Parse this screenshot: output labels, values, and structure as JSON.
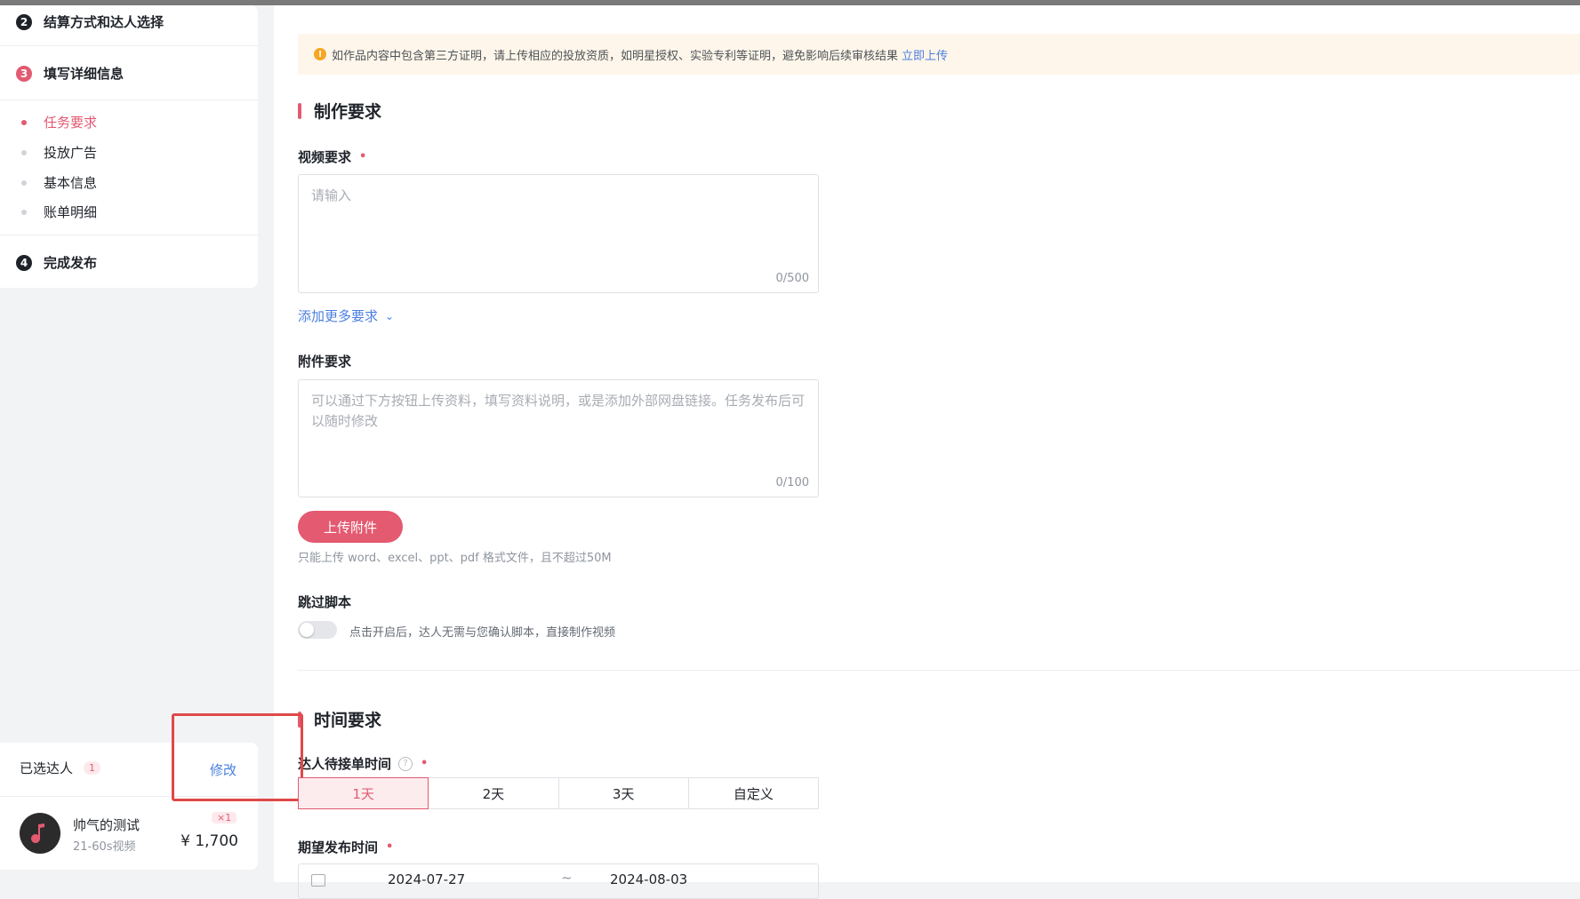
{
  "steps": [
    {
      "num": "2",
      "label": "结算方式和达人选择"
    },
    {
      "num": "3",
      "label": "填写详细信息"
    },
    {
      "num": "4",
      "label": "完成发布"
    }
  ],
  "subitems": [
    "任务要求",
    "投放广告",
    "基本信息",
    "账单明细"
  ],
  "selected": {
    "title": "已选达人",
    "count": "1",
    "edit_label": "修改",
    "name": "帅气的测试",
    "type": "21-60s视频",
    "qty": "×1",
    "price": "¥ 1,700"
  },
  "notice": {
    "text": "如作品内容中包含第三方证明，请上传相应的投放资质，如明星授权、实验专利等证明，避免影响后续审核结果",
    "link": "立即上传"
  },
  "production": {
    "title": "制作要求",
    "video_label": "视频要求",
    "video_placeholder": "请输入",
    "video_count": "0/500",
    "more_link": "添加更多要求",
    "attach_label": "附件要求",
    "attach_placeholder": "可以通过下方按钮上传资料，填写资料说明，或是添加外部网盘链接。任务发布后可以随时修改",
    "attach_count": "0/100",
    "upload_button": "上传附件",
    "upload_hint": "只能上传 word、excel、ppt、pdf 格式文件，且不超过50M",
    "skip_label": "跳过脚本",
    "skip_hint": "点击开启后，达人无需与您确认脚本，直接制作视频"
  },
  "time": {
    "title": "时间要求",
    "wait_label": "达人待接单时间",
    "options": [
      "1天",
      "2天",
      "3天",
      "自定义"
    ],
    "publish_label": "期望发布时间",
    "date_start": "2024-07-27",
    "date_sep": "~",
    "date_end": "2024-08-03"
  },
  "colors": {
    "accent": "#e35a71",
    "link": "#4a7fe0",
    "highlight": "#e04848"
  }
}
